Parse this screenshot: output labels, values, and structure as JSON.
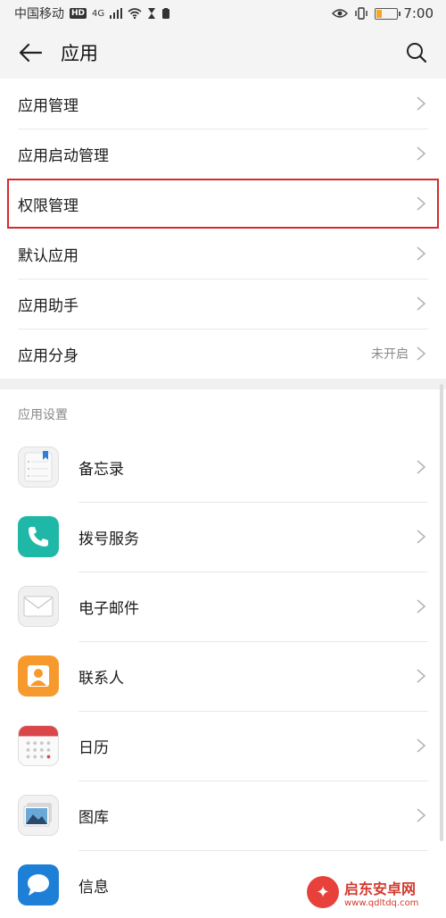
{
  "status_bar": {
    "carrier": "中国移动",
    "hd": "HD",
    "network": "4G",
    "time": "7:00",
    "battery_level": 0.25
  },
  "app_bar": {
    "title": "应用",
    "back_icon": "arrow-left-icon",
    "search_icon": "search-icon"
  },
  "menu": [
    {
      "label": "应用管理"
    },
    {
      "label": "应用启动管理"
    },
    {
      "label": "权限管理"
    },
    {
      "label": "默认应用"
    },
    {
      "label": "应用助手"
    },
    {
      "label": "应用分身",
      "status": "未开启"
    }
  ],
  "section": {
    "title": "应用设置"
  },
  "apps": [
    {
      "label": "备忘录",
      "icon": "notepad-icon"
    },
    {
      "label": "拨号服务",
      "icon": "phone-icon"
    },
    {
      "label": "电子邮件",
      "icon": "mail-icon"
    },
    {
      "label": "联系人",
      "icon": "contacts-icon"
    },
    {
      "label": "日历",
      "icon": "calendar-icon"
    },
    {
      "label": "图库",
      "icon": "gallery-icon"
    },
    {
      "label": "信息",
      "icon": "message-icon"
    }
  ],
  "watermark": {
    "name": "启东安卓网",
    "url": "www.qdltdq.com"
  },
  "colors": {
    "highlight": "#d42b2b",
    "phone": "#1fb8a6",
    "contacts": "#f79a2d",
    "message": "#1e7fd6"
  }
}
